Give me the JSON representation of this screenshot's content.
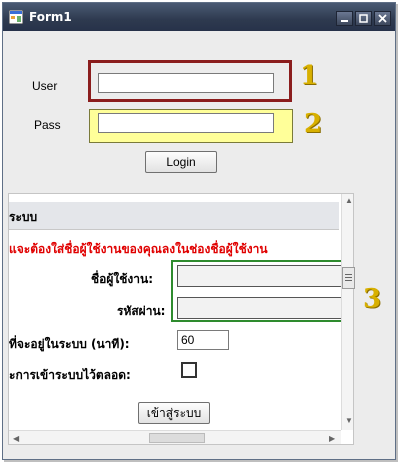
{
  "window": {
    "title": "Form1"
  },
  "login": {
    "user_label": "User",
    "pass_label": "Pass",
    "user_value": "",
    "pass_value": "",
    "login_button": "Login"
  },
  "markers": {
    "m1": "1",
    "m2": "2",
    "m3": "3"
  },
  "panel": {
    "section_title": "ระบบ",
    "warning": "แจะต้องใส่ชื่อผู้ใช้งานของคุณลงในช่องชื่อผู้ใช้งาน",
    "username_label": "ชื่อผู้ใช้งาน:",
    "password_label": "รหัสผ่าน:",
    "timeout_label": "ที่จะอยู่ในระบบ (นาที):",
    "timeout_value": "60",
    "remember_label": "ะการเข้าระบบไว้ตลอด:",
    "remember_checked": false,
    "submit_button": "เข้าสู่ระบบ"
  },
  "colors": {
    "marker": "#d8b000",
    "warning": "#e00000",
    "frame_red": "#8b1d1d",
    "frame_yellow_fill": "#ffff99",
    "frame_green": "#2e8b2e"
  }
}
